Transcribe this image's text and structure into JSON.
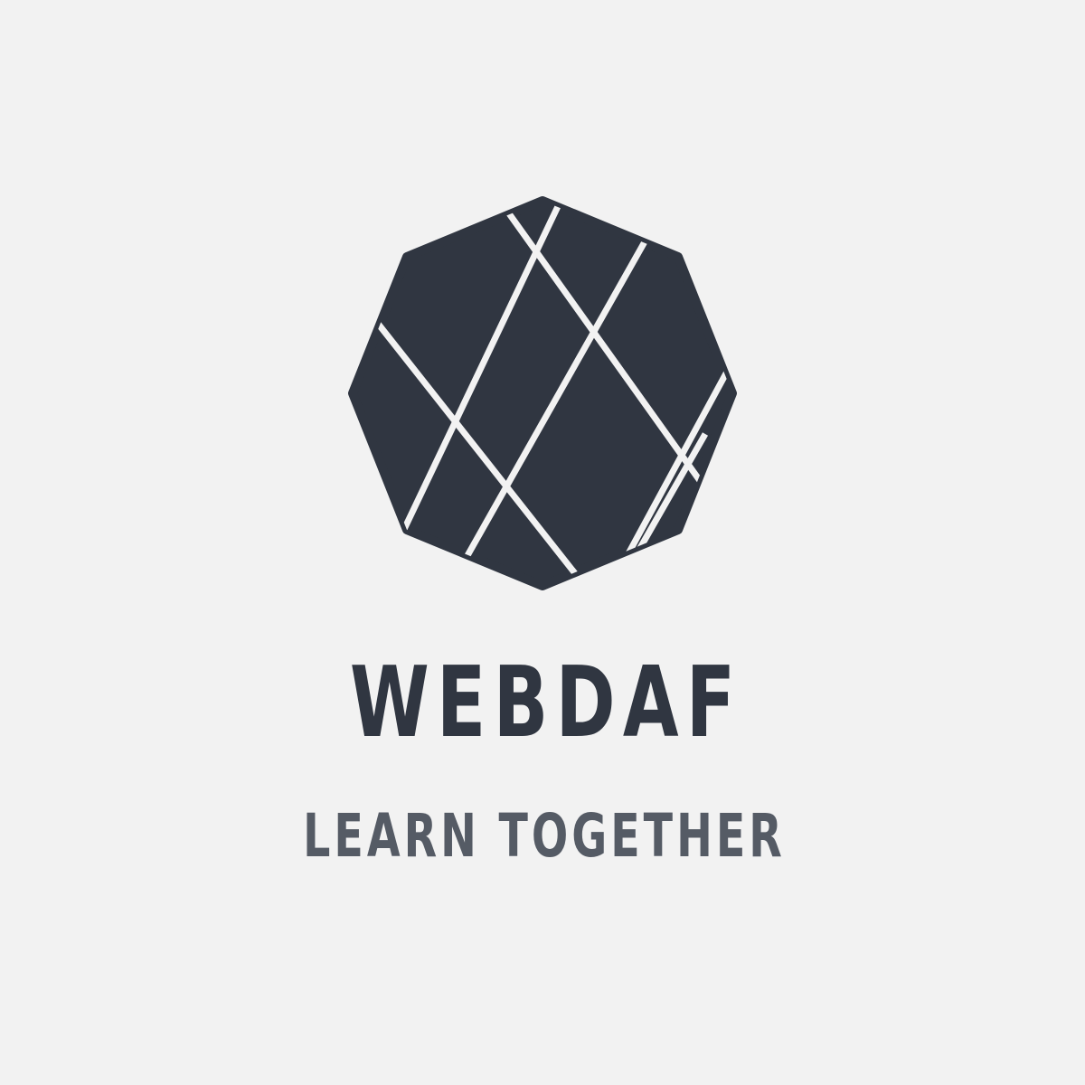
{
  "logo": {
    "icon": "faceted-octagon-icon",
    "brand_name": "WEBDAF",
    "tagline": "LEARN TOGETHER"
  },
  "colors": {
    "background": "#f2f2f2",
    "emblem": "#303641",
    "brand_text": "#303641",
    "tagline_text": "#555b65",
    "facet_lines": "#f2f2f2"
  }
}
